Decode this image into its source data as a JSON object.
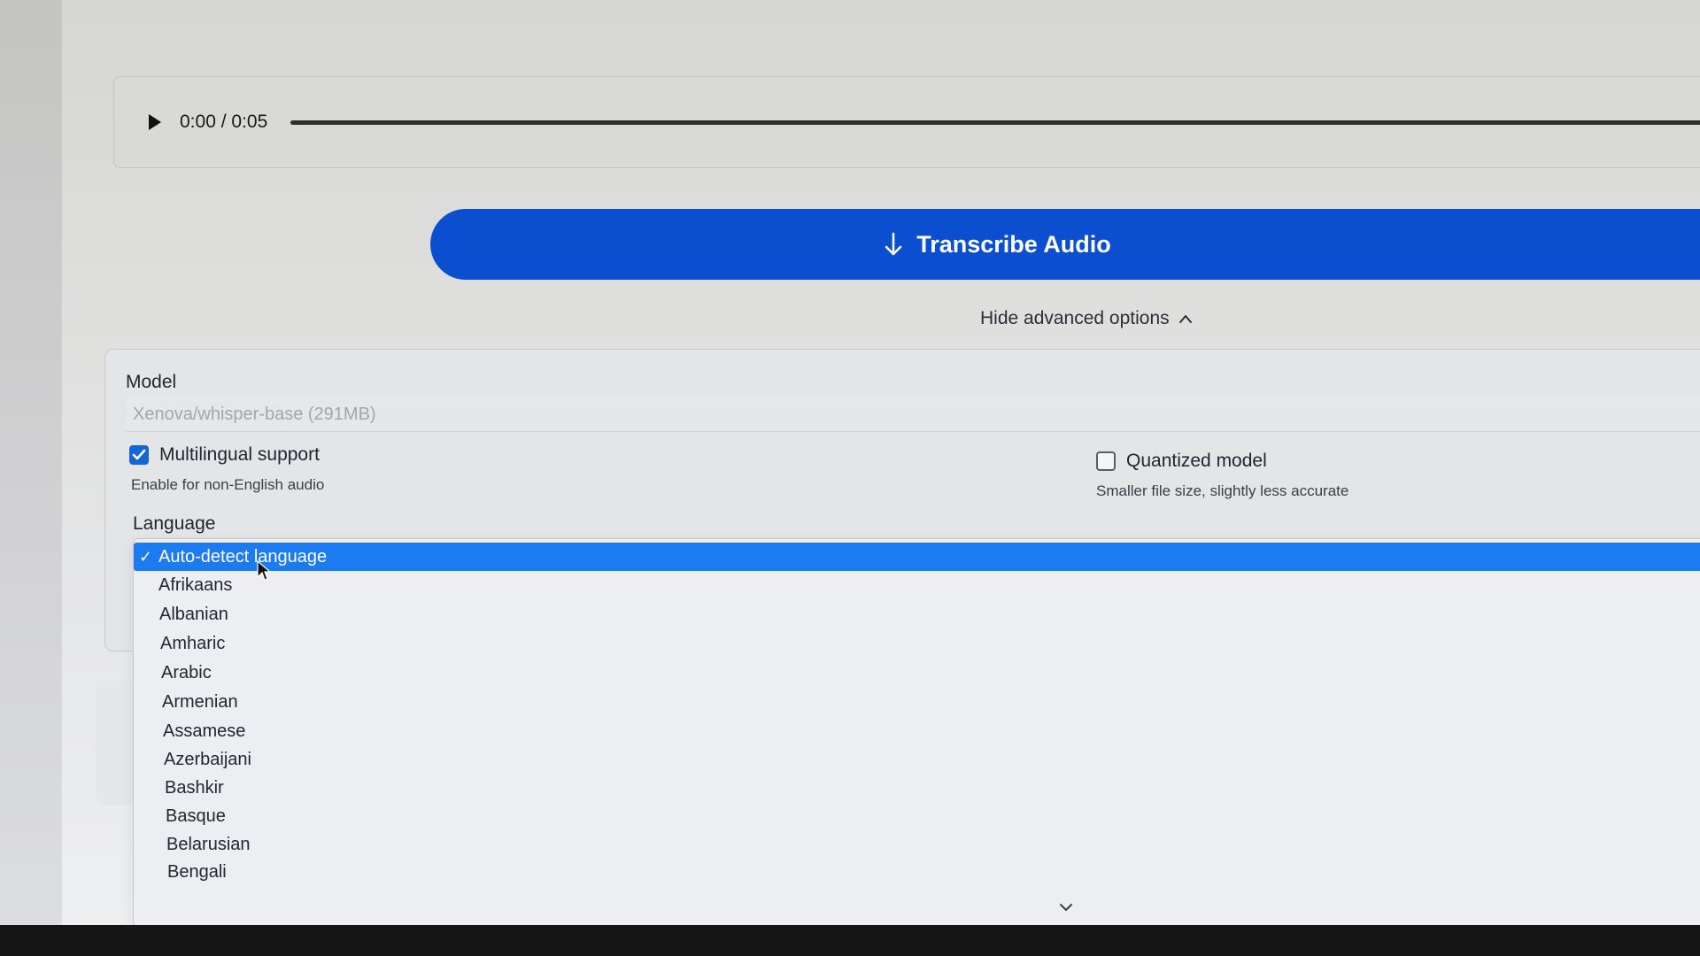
{
  "audio_player": {
    "time": "0:00 / 0:05",
    "progress": 0
  },
  "actions": {
    "transcribe_label": "Transcribe Audio",
    "advanced_toggle_label": "Hide advanced options"
  },
  "options": {
    "model_label": "Model",
    "model_value": "Xenova/whisper-base (291MB)",
    "multilingual": {
      "label": "Multilingual support",
      "hint": "Enable for non-English audio",
      "checked": true
    },
    "quantized": {
      "label": "Quantized model",
      "hint": "Smaller file size, slightly less accurate",
      "checked": false
    },
    "language_label": "Language"
  },
  "language_dropdown": {
    "selected": "Auto-detect language",
    "items": [
      "Afrikaans",
      "Albanian",
      "Amharic",
      "Arabic",
      "Armenian",
      "Assamese",
      "Azerbaijani",
      "Bashkir",
      "Basque",
      "Belarusian",
      "Bengali"
    ]
  },
  "colors": {
    "primary_button": "#0b4fd0",
    "selected_item": "#1c7bf0",
    "checkbox_checked": "#1466d6"
  },
  "icons": {
    "play": "play-icon",
    "transcribe": "arrow-down-icon",
    "toggle": "chevron-up-icon",
    "dropdown_scroll": "chevron-down-icon",
    "cursor": "mouse-pointer-icon"
  }
}
